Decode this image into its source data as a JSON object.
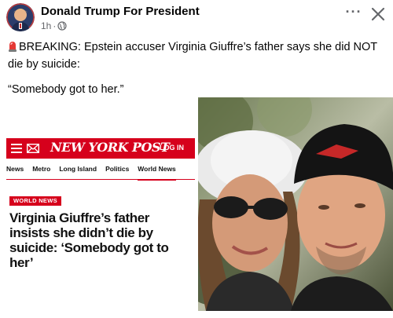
{
  "post": {
    "author": "Donald Trump For President",
    "time": "1h",
    "separator": "·",
    "privacy_icon": "globe-icon",
    "text_line": "BREAKING: Epstein accuser Virginia Giuffre’s father says she did NOT die by suicide:",
    "quote": "“Somebody got to her.”",
    "siren_icon": "police-siren-emoji"
  },
  "link_image": {
    "nyp": {
      "logo": "NEW YORK POST",
      "login": "LOG IN",
      "nav": [
        "News",
        "Metro",
        "Long Island",
        "Politics",
        "World News"
      ],
      "tag": "WORLD NEWS",
      "headline": "Virginia Giuffre’s father insists she didn’t die by suicide: ‘Somebody got to her’"
    }
  },
  "colors": {
    "nyp_red": "#d6001c",
    "meta_gray": "#65676b",
    "text": "#050505"
  }
}
